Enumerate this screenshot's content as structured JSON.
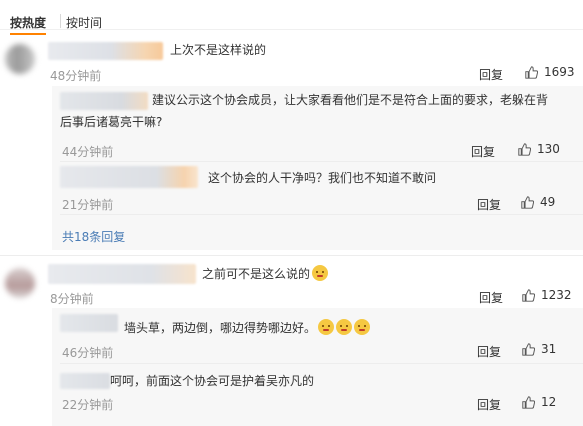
{
  "tabs": {
    "hot": "按热度",
    "time": "按时间"
  },
  "comments": [
    {
      "text": "上次不是这样说的",
      "time": "48分钟前",
      "reply": "回复",
      "likes": "1693",
      "replies": [
        {
          "text_line1": "建议公示这个协会成员，让大家看看他们是不是符合上面的要求，老躲在背",
          "text_line2": "后事后诸葛亮干嘛?",
          "time": "44分钟前",
          "reply": "回复",
          "likes": "130"
        },
        {
          "text": "这个协会的人干净吗？我们也不知道不敢问",
          "time": "21分钟前",
          "reply": "回复",
          "likes": "49"
        }
      ],
      "more": "共18条回复"
    },
    {
      "text": "之前可不是这么说的",
      "time": "8分钟前",
      "reply": "回复",
      "likes": "1232",
      "replies": [
        {
          "text": "墙头草，两边倒，哪边得势哪边好。",
          "time": "46分钟前",
          "reply": "回复",
          "likes": "31"
        },
        {
          "text": "呵呵，前面这个协会可是护着吴亦凡的",
          "time": "22分钟前",
          "reply": "回复",
          "likes": "12"
        }
      ]
    }
  ]
}
